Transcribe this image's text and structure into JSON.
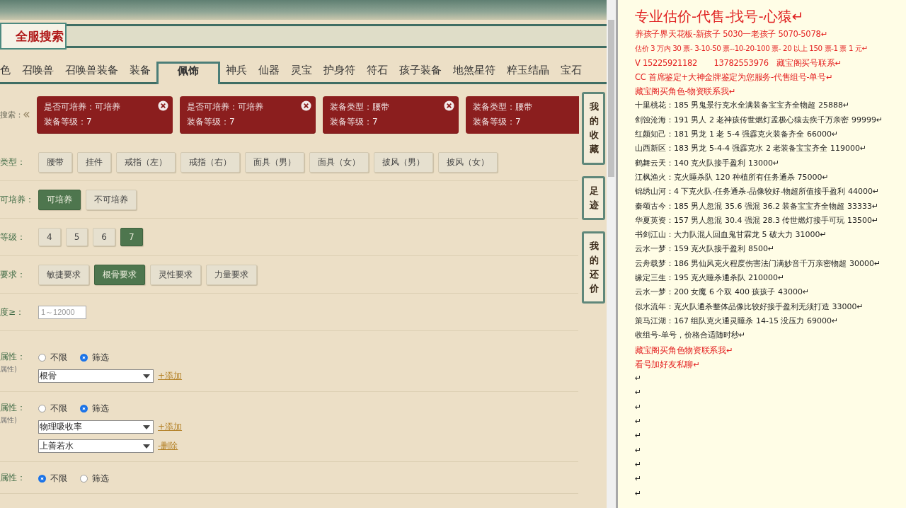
{
  "logo": {
    "title": "全服搜索"
  },
  "tabs": [
    {
      "label": "色",
      "selected": false
    },
    {
      "label": "召唤兽",
      "selected": false
    },
    {
      "label": "召唤兽装备",
      "selected": false
    },
    {
      "label": "装备",
      "selected": false
    },
    {
      "label": "佩饰",
      "selected": true
    },
    {
      "label": "神兵",
      "selected": false
    },
    {
      "label": "仙器",
      "selected": false
    },
    {
      "label": "灵宝",
      "selected": false
    },
    {
      "label": "护身符",
      "selected": false
    },
    {
      "label": "符石",
      "selected": false
    },
    {
      "label": "孩子装备",
      "selected": false
    },
    {
      "label": "地煞星符",
      "selected": false
    },
    {
      "label": "粹玉结晶",
      "selected": false
    },
    {
      "label": "宝石",
      "selected": false
    }
  ],
  "search_history": {
    "label": "搜索：",
    "chips": [
      {
        "line_1": "是否可培养：可培养",
        "line_2": "装备等级：7",
        "removable": true
      },
      {
        "line_1": "是否可培养：可培养",
        "line_2": "装备等级：7",
        "removable": true
      },
      {
        "line_1": "装备类型：腰带",
        "line_2": "装备等级：7",
        "removable": true
      },
      {
        "line_1": "装备类型：腰带",
        "line_2": "装备等级：7",
        "removable": false
      }
    ]
  },
  "side_nav": [
    {
      "label": "我的收藏"
    },
    {
      "label": "足迹"
    },
    {
      "label": "我的还价"
    }
  ],
  "filters": [
    {
      "kind": "options",
      "label": "类型：",
      "options": [
        {
          "label": "腰带",
          "selected": false
        },
        {
          "label": "挂件",
          "selected": false
        },
        {
          "label": "戒指（左）",
          "selected": false
        },
        {
          "label": "戒指（右）",
          "selected": false
        },
        {
          "label": "面具（男）",
          "selected": false
        },
        {
          "label": "面具（女）",
          "selected": false
        },
        {
          "label": "披风（男）",
          "selected": false
        },
        {
          "label": "披风（女）",
          "selected": false
        }
      ]
    },
    {
      "kind": "options",
      "label": "可培养：",
      "options": [
        {
          "label": "可培养",
          "selected": true
        },
        {
          "label": "不可培养",
          "selected": false
        }
      ]
    },
    {
      "kind": "options",
      "label": "等级：",
      "options": [
        {
          "label": "4",
          "selected": false
        },
        {
          "label": "5",
          "selected": false
        },
        {
          "label": "6",
          "selected": false
        },
        {
          "label": "7",
          "selected": true
        }
      ]
    },
    {
      "kind": "options",
      "label": "要求：",
      "options": [
        {
          "label": "敏捷要求",
          "selected": false
        },
        {
          "label": "根骨要求",
          "selected": true
        },
        {
          "label": "灵性要求",
          "selected": false
        },
        {
          "label": "力量要求",
          "selected": false
        }
      ]
    },
    {
      "kind": "input",
      "label": "度≥：",
      "placeholder": "1～12000"
    }
  ],
  "attributes": [
    {
      "label": "属性：",
      "sublabel": "属性)",
      "choices": [
        {
          "label": "不限",
          "selected": false
        },
        {
          "label": "筛选",
          "selected": true
        }
      ],
      "selects": [
        {
          "value": "根骨",
          "action": "+添加"
        }
      ]
    },
    {
      "label": "属性：",
      "sublabel": "属性)",
      "choices": [
        {
          "label": "不限",
          "selected": false
        },
        {
          "label": "筛选",
          "selected": true
        }
      ],
      "selects": [
        {
          "value": "物理吸收率",
          "action": "+添加"
        },
        {
          "value": "上善若水",
          "action": "-删除"
        }
      ]
    },
    {
      "label": "属性：",
      "choices": [
        {
          "label": "不限",
          "selected": true
        },
        {
          "label": "筛选",
          "selected": false
        }
      ]
    }
  ],
  "document": {
    "title": "专业估价-代售-找号-心猿↵",
    "lines": [
      {
        "kind": "highlight",
        "text": "养孩子界天花板-新孩子 5030一老孩子 5070-5078↵"
      },
      {
        "kind": "highlight",
        "text": "估价 3 万内 30 票- 3-10-50 票--10-20-100 票- 20 以上 150 票-1 票 1 元↵"
      },
      {
        "kind": "highlight",
        "text": "V 15225921182　　13782553976　藏宝阁买号联系↵"
      },
      {
        "kind": "highlight",
        "text": "CC 首席鉴定+大神金牌鉴定为您服务-代售组号-单号↵"
      },
      {
        "kind": "highlight",
        "text": "藏宝阁买角色-物资联系我↵"
      },
      {
        "kind": "plain",
        "text": "十里桃花：185 男鬼景行克水全满装备宝宝齐全物超 25888↵"
      },
      {
        "kind": "plain",
        "text": "剑蚀沧海：191 男人 2 老神孩传世燃灯孟极心猿去疾千万亲密 99999↵"
      },
      {
        "kind": "plain",
        "text": "红颜知己：181 男龙 1 老 5-4 强霹克火装备齐全 66000↵"
      },
      {
        "kind": "plain",
        "text": "山西新区：183 男龙 5-4-4 强霹克水 2 老装备宝宝齐全 119000↵"
      },
      {
        "kind": "plain",
        "text": "鹤舞云天：140 克火队接手盈利 13000↵"
      },
      {
        "kind": "plain",
        "text": "江枫渔火：克火睡杀队 120 种植所有任务通杀 75000↵"
      },
      {
        "kind": "plain",
        "text": "锦绣山河：4 下克火队-任务通杀-品像较好-物超所值接手盈利 44000↵"
      },
      {
        "kind": "plain",
        "text": "秦颂古今：185 男人忽混 35.6 强混 36.2 装备宝宝齐全物超 33333↵"
      },
      {
        "kind": "plain",
        "text": "华夏英资：157 男人忽混 30.4 强混 28.3 传世燃灯接手可玩 13500↵"
      },
      {
        "kind": "plain",
        "text": "书剑江山：大力队混人回血鬼甘霖龙 5 破大力 31000↵"
      },
      {
        "kind": "plain",
        "text": "云水一梦：159 克火队接手盈利 8500↵"
      },
      {
        "kind": "plain",
        "text": "云舟载梦：186 男仙风克火程度伤害法门满妙音千万亲密物超 30000↵"
      },
      {
        "kind": "plain",
        "text": "缘定三生：195 克火睡杀通杀队 210000↵"
      },
      {
        "kind": "plain",
        "text": "云水一梦：200 女魔 6 个双 400 孩孩子 43000↵"
      },
      {
        "kind": "plain",
        "text": "似水流年：克火队通杀整体品像比较好接手盈利无须打造 33000↵"
      },
      {
        "kind": "plain",
        "text": "策马江湖：167 组队克火通灵睡杀 14-15 没压力 69000↵"
      },
      {
        "kind": "plain",
        "text": "收组号-单号，价格合适随时秒↵"
      },
      {
        "kind": "highlight",
        "text": "藏宝阁买角色物资联系我↵"
      },
      {
        "kind": "highlight",
        "text": "看号加好友私聊↵"
      },
      {
        "kind": "plain",
        "text": "↵"
      },
      {
        "kind": "plain",
        "text": "↵"
      },
      {
        "kind": "plain",
        "text": "↵"
      },
      {
        "kind": "plain",
        "text": "↵"
      },
      {
        "kind": "plain",
        "text": "↵"
      },
      {
        "kind": "plain",
        "text": "↵"
      },
      {
        "kind": "plain",
        "text": "↵"
      },
      {
        "kind": "plain",
        "text": "↵"
      },
      {
        "kind": "plain",
        "text": "↵"
      }
    ]
  }
}
